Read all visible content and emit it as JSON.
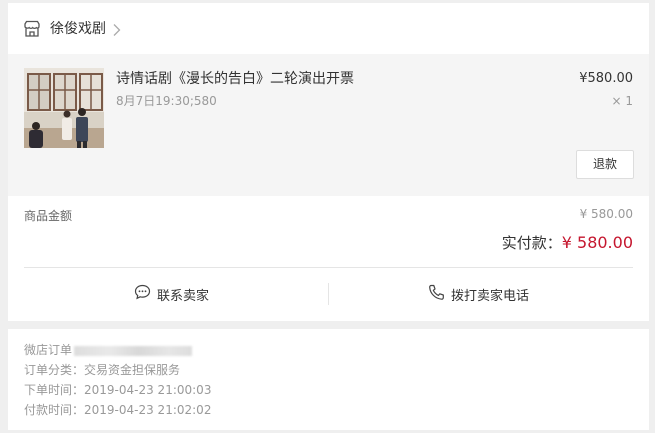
{
  "store": {
    "name": "徐俊戏剧"
  },
  "item": {
    "title": "诗情话剧《漫长的告白》二轮演出开票",
    "sku": "8月7日19:30;580",
    "price": "¥580.00",
    "quantity": "× 1",
    "refund_label": "退款"
  },
  "totals": {
    "goods_label": "商品金额",
    "goods_value": "¥ 580.00",
    "paid_label": "实付款：",
    "paid_value": "¥ 580.00"
  },
  "actions": {
    "contact_label": "联系卖家",
    "call_label": "拨打卖家电话"
  },
  "order_info": {
    "order_no_label": "微店订单",
    "category": "订单分类：交易资金担保服务",
    "order_time": "下单时间：2019-04-23 21:00:03",
    "pay_time": "付款时间：2019-04-23 21:02:02"
  },
  "icons": {
    "store": "store-icon",
    "chevron": "chevron-right-icon",
    "chat": "chat-bubble-icon",
    "phone": "phone-icon"
  },
  "colors": {
    "accent_red": "#c5162e",
    "page_bg": "#efefef"
  }
}
